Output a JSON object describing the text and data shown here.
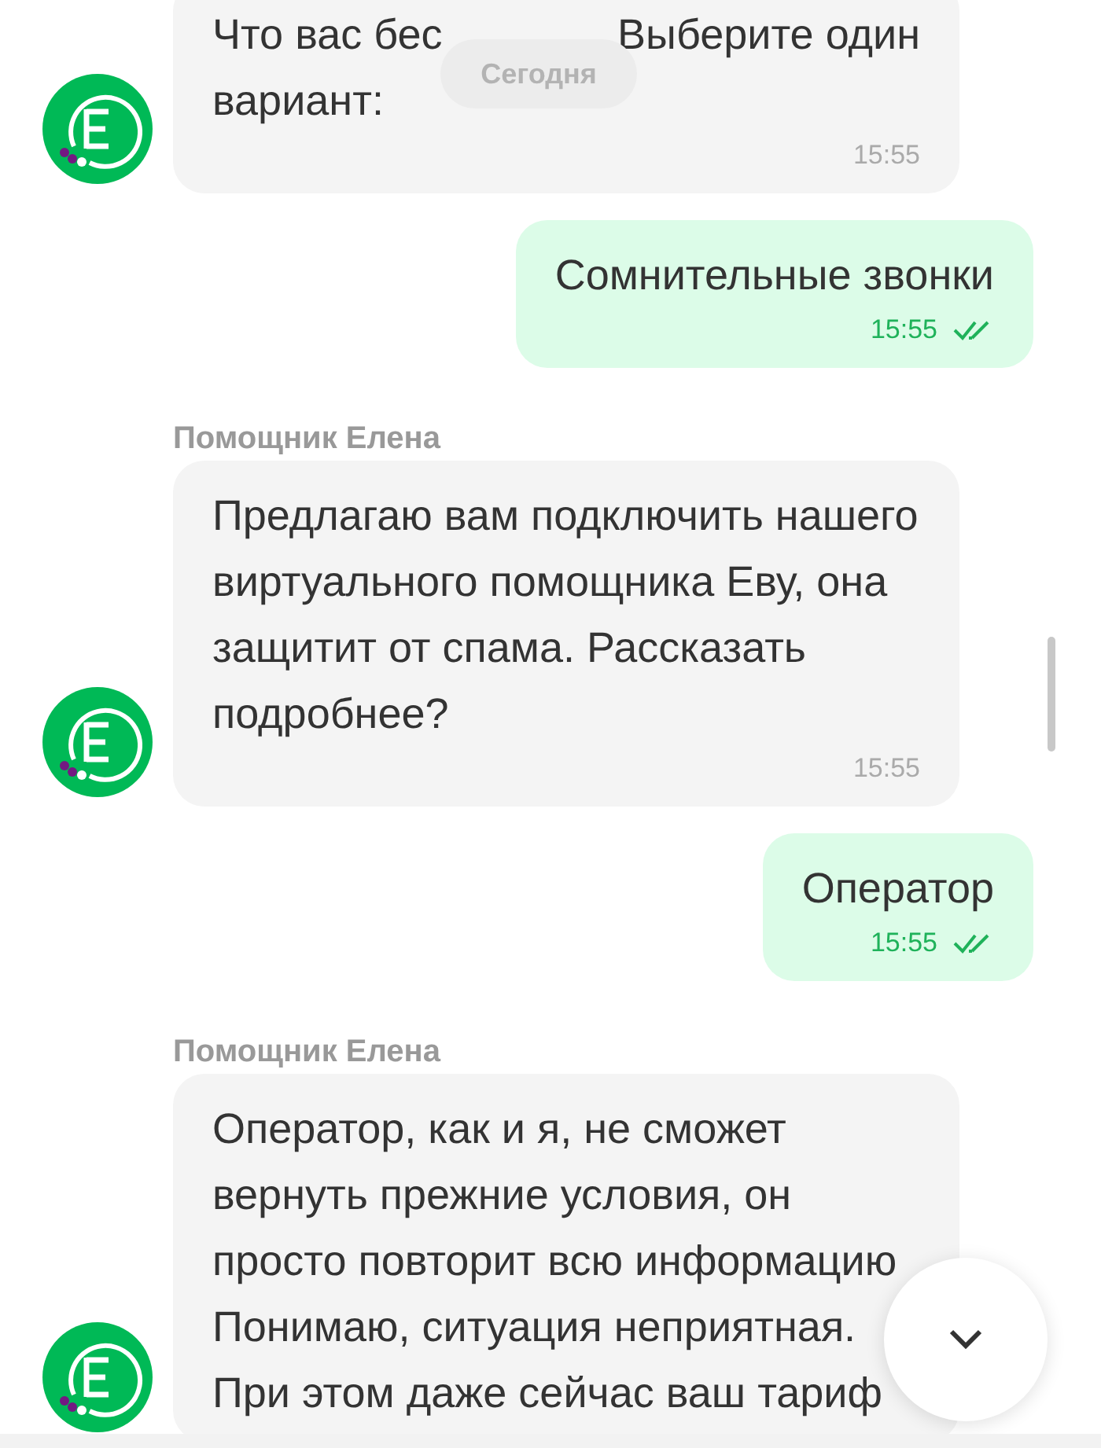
{
  "date_badge": "Сегодня",
  "messages": [
    {
      "kind": "incoming",
      "text_parts": [
        "Что вас бес",
        "Выберите один",
        "вариант:"
      ],
      "time": "15:55"
    },
    {
      "kind": "outgoing",
      "text": "Сомнительные звонки",
      "time": "15:55",
      "read": true
    },
    {
      "kind": "incoming",
      "sender": "Помощник Елена",
      "text": "Предлагаю вам подключить нашего виртуального помощника Еву, она защитит от спама. Рассказать подробнее?",
      "time": "15:55"
    },
    {
      "kind": "outgoing",
      "text": "Оператор",
      "time": "15:55",
      "read": true
    },
    {
      "kind": "incoming",
      "sender": "Помощник Елена",
      "text": "Оператор, как и я, не сможет вернуть прежние условия, он просто повторит всю информацию Понимаю, ситуация неприятная. При этом даже сейчас ваш тариф"
    }
  ]
}
